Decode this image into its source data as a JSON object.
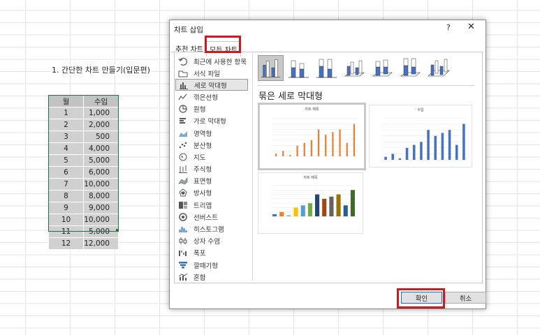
{
  "sheet": {
    "title": "1. 간단한 차트 만들기(입문편)",
    "headers": [
      "월",
      "수입"
    ],
    "rows": [
      [
        "1",
        "1,000"
      ],
      [
        "2",
        "2,000"
      ],
      [
        "3",
        "500"
      ],
      [
        "4",
        "4,000"
      ],
      [
        "5",
        "5,000"
      ],
      [
        "6",
        "6,000"
      ],
      [
        "7",
        "10,000"
      ],
      [
        "8",
        "8,000"
      ],
      [
        "9",
        "9,000"
      ],
      [
        "10",
        "10,000"
      ],
      [
        "11",
        "5,000"
      ],
      [
        "12",
        "12,000"
      ]
    ]
  },
  "dialog": {
    "title": "차트 삽입",
    "help": "?",
    "close": "✕",
    "tabs": {
      "recommended": "추천 차트",
      "all": "모든 차트"
    },
    "sidebar": [
      {
        "label": "최근에 사용한 항목",
        "icon": "undo-icon"
      },
      {
        "label": "서식 파일",
        "icon": "folder-icon"
      },
      {
        "label": "세로 막대형",
        "icon": "column-chart-icon",
        "selected": true
      },
      {
        "label": "꺾은선형",
        "icon": "line-chart-icon"
      },
      {
        "label": "원형",
        "icon": "pie-chart-icon"
      },
      {
        "label": "가로 막대형",
        "icon": "bar-chart-icon"
      },
      {
        "label": "영역형",
        "icon": "area-chart-icon"
      },
      {
        "label": "분산형",
        "icon": "scatter-chart-icon"
      },
      {
        "label": "지도",
        "icon": "map-chart-icon"
      },
      {
        "label": "주식형",
        "icon": "stock-chart-icon"
      },
      {
        "label": "표면형",
        "icon": "surface-chart-icon"
      },
      {
        "label": "방사형",
        "icon": "radar-chart-icon"
      },
      {
        "label": "트리맵",
        "icon": "treemap-icon"
      },
      {
        "label": "선버스트",
        "icon": "sunburst-icon"
      },
      {
        "label": "히스토그램",
        "icon": "histogram-icon"
      },
      {
        "label": "상자 수염",
        "icon": "box-whisker-icon"
      },
      {
        "label": "폭포",
        "icon": "waterfall-icon"
      },
      {
        "label": "깔때기형",
        "icon": "funnel-icon"
      },
      {
        "label": "혼합",
        "icon": "combo-chart-icon"
      }
    ],
    "subtype_heading": "묶은 세로 막대형",
    "preview1_title": "차트 제목",
    "preview2_title": "수입",
    "preview3_title": "차트 제목",
    "ok": "확인",
    "cancel": "취소"
  },
  "colors": {
    "orange": "#ed7d31",
    "blue": "#4472c4",
    "highlight": "#d0181e",
    "excel_green": "#217346"
  },
  "chart_data": {
    "type": "bar",
    "categories": [
      "1",
      "2",
      "3",
      "4",
      "5",
      "6",
      "7",
      "8",
      "9",
      "10",
      "11",
      "12"
    ],
    "values": [
      1000,
      2000,
      500,
      4000,
      5000,
      6000,
      10000,
      8000,
      9000,
      10000,
      5000,
      12000
    ],
    "ylim": [
      0,
      14000
    ]
  }
}
